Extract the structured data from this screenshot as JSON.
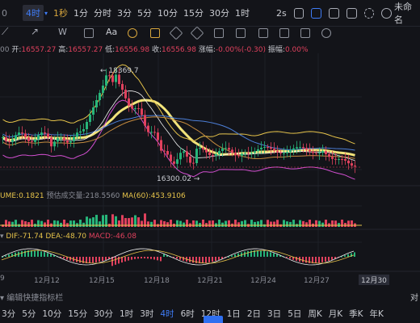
{
  "toolbar": {
    "partial_left": "0",
    "active_timeframe": "4时",
    "timeframes": [
      "1秒",
      "1分",
      "分时",
      "3分",
      "5分",
      "10分",
      "15分",
      "30分",
      "1时"
    ],
    "speed": "2s",
    "right_label": "未命名",
    "icons": [
      "camera-icon",
      "pencil-icon",
      "layout-icon",
      "sliders-icon",
      "settings-icon",
      "cloud-icon"
    ]
  },
  "ohlc": {
    "prefix": "00",
    "open_label": "开:",
    "open": "16557.27",
    "high_label": "高:",
    "high": "16557.27",
    "low_label": "低:",
    "low": "16556.98",
    "close_label": "收:",
    "close": "16556.98",
    "change_label": "涨幅:",
    "change": "-0.00%(-0.30)",
    "amp_label": "振幅:",
    "amp": "0.00%"
  },
  "annotations": {
    "high_marker": "← 18369.7",
    "low_marker": "16300.02 →"
  },
  "volume": {
    "vol_label": "UME:0.1821",
    "est_label": "预估成交量:218.5560",
    "ma_label": "MA(60):453.9106"
  },
  "macd": {
    "dif": "DIF:-71.74",
    "dea": "DEA:-48.70",
    "macd": "MACD:-46.08"
  },
  "dates": [
    "9",
    "12月12",
    "12月15",
    "12月18",
    "12月21",
    "12月24",
    "12月27",
    "12月30"
  ],
  "indicator_row": {
    "label": "编辑快捷指标栏",
    "right": "对"
  },
  "bottom_timeframes": [
    "3分",
    "5分",
    "10分",
    "15分",
    "30分",
    "1时",
    "3时",
    "4时",
    "6时",
    "12时",
    "1日",
    "2日",
    "3日",
    "5日",
    "周K",
    "月K",
    "季K",
    "年K"
  ],
  "bottom_active": "4时",
  "colors": {
    "up": "#27b57a",
    "down": "#e0415d",
    "accent": "#3f7cf6",
    "ma_yellow": "#f2e47a",
    "background": "#131419"
  }
}
